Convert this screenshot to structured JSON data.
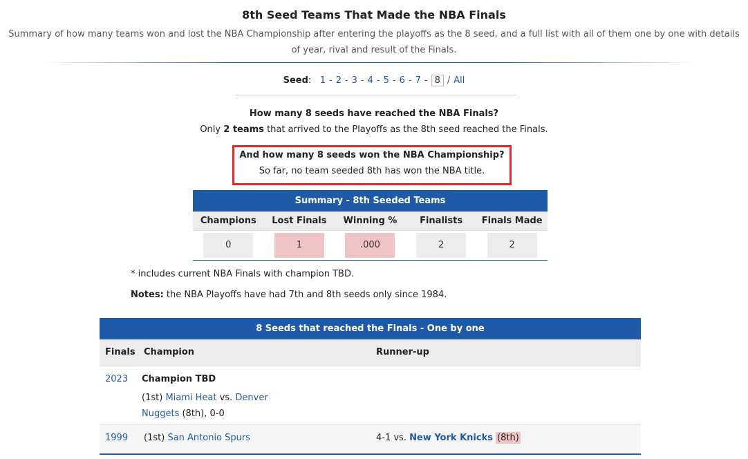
{
  "header": {
    "title": "8th Seed Teams That Made the NBA Finals",
    "subtitle": "Summary of how many teams won and lost the NBA Championship after entering the playoffs as the 8 seed, and a full list with all of them one by one with details of year, rival and result of the Finals."
  },
  "seed_nav": {
    "label": "Seed",
    "colon": ":",
    "items": [
      "1",
      "2",
      "3",
      "4",
      "5",
      "6",
      "7"
    ],
    "current": "8",
    "all": "All",
    "dash": "-",
    "slash": "/"
  },
  "q1": {
    "question": "How many 8 seeds have reached the NBA Finals?",
    "pre": "Only",
    "bold": "2 teams",
    "post": "that arrived to the Playoffs as the 8th seed reached the Finals."
  },
  "q2": {
    "question": "And how many 8 seeds won the NBA Championship?",
    "answer": "So far, no team seeded 8th has won the NBA title."
  },
  "summary": {
    "title": "Summary - 8th Seeded Teams",
    "columns": [
      "Champions",
      "Lost Finals",
      "Winning %",
      "Finalists",
      "Finals Made"
    ],
    "values": [
      "0",
      "1",
      ".000",
      "2",
      "2"
    ]
  },
  "notes": {
    "footnote": "* includes current NBA Finals with champion TBD.",
    "label": "Notes:",
    "text": "the NBA Playoffs have had 7th and 8th seeds only since 1984."
  },
  "list": {
    "title": "8 Seeds that reached the Finals - One by one",
    "columns": {
      "finals": "Finals",
      "champion": "Champion",
      "runner_up": "Runner-up"
    },
    "rows": [
      {
        "year": "2023",
        "champion_status": "Champion TBD",
        "seed1": "(1st)",
        "team1": "Miami Heat",
        "vs": "vs.",
        "team2_part1": "Denver",
        "team2_part2": "Nuggets",
        "seed2_result": "(8th), 0-0"
      },
      {
        "year": "1999",
        "champ_seed": "(1st)",
        "champion": "San Antonio Spurs",
        "result": "4-1 vs.",
        "runner_up": "New York Knicks",
        "runner_seed": "(8th)"
      }
    ]
  },
  "colors": {
    "accent_blue": "#1f5aa6",
    "highlight_red": "#e02a2a",
    "pink_cell": "#efc4c4",
    "grey_cell": "#ececec"
  }
}
